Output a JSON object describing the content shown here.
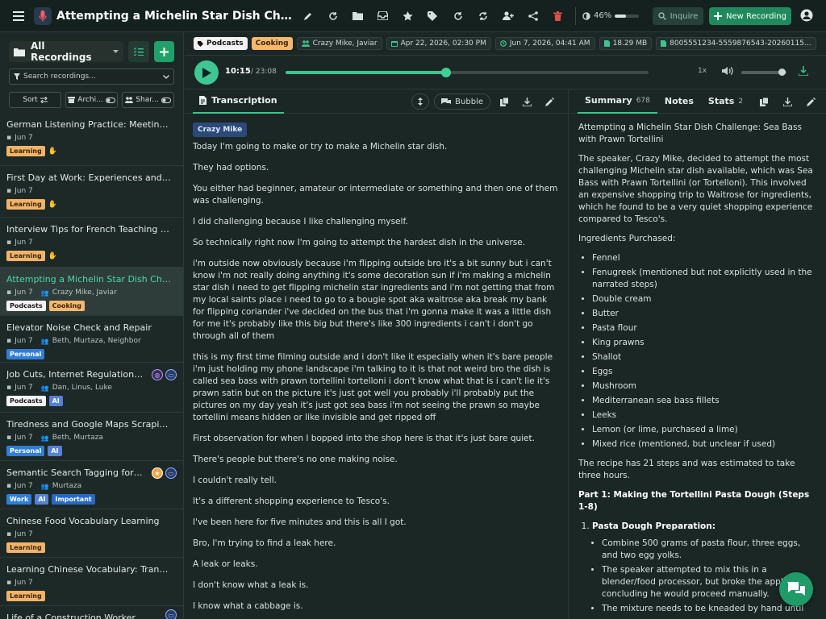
{
  "header": {
    "title": "Attempting a Michelin Star Dish Challenge: Sea Bass with Prawn Tortellini",
    "battery": {
      "percent_label": "46%",
      "fraction": 0.46
    },
    "inquire_label": "Inquire",
    "new_recording_label": "New Recording",
    "icons": [
      "menu-icon",
      "microphone-icon",
      "edit-icon",
      "refresh-icon",
      "folder-icon",
      "inbox-icon",
      "star-icon",
      "tag-icon",
      "redo-icon",
      "sync-icon",
      "user-add-icon",
      "share-icon",
      "delete-icon",
      "battery-icon",
      "search-icon",
      "plus-icon",
      "account-icon"
    ]
  },
  "sidebar": {
    "header_label": "All Recordings",
    "search_placeholder": "Search recordings...",
    "filters": {
      "sort_label": "Sort",
      "archive_label": "Archi...",
      "shared_label": "Shar..."
    },
    "recordings": [
      {
        "title": "German Listening Practice: Meeting New People",
        "date": "Jun 7",
        "participants": "",
        "tags": [
          {
            "label": "Learning",
            "kind": "learning"
          }
        ],
        "has_kb": true,
        "badges": []
      },
      {
        "title": "First Day at Work: Experiences and Challenges",
        "date": "Jun 7",
        "participants": "",
        "tags": [
          {
            "label": "Learning",
            "kind": "learning"
          }
        ],
        "has_kb": true,
        "badges": []
      },
      {
        "title": "Interview Tips for French Teaching Position",
        "date": "Jun 7",
        "participants": "",
        "tags": [
          {
            "label": "Learning",
            "kind": "learning"
          }
        ],
        "has_kb": true,
        "badges": []
      },
      {
        "title": "Attempting a Michelin Star Dish Challenge",
        "date": "Jun 7",
        "participants": "Crazy Mike, Javiar",
        "tags": [
          {
            "label": "Podcasts",
            "kind": "podcasts"
          },
          {
            "label": "Cooking",
            "kind": "cooking"
          }
        ],
        "has_kb": false,
        "badges": [],
        "active": true
      },
      {
        "title": "Elevator Noise Check and Repair",
        "date": "Jun 7",
        "participants": "Beth, Murtaza, Neighbor",
        "tags": [
          {
            "label": "Personal",
            "kind": "personal"
          }
        ],
        "has_kb": false,
        "badges": []
      },
      {
        "title": "Job Cuts, Internet Regulations, and Tech",
        "date": "Jun 7",
        "participants": "Dan, Linus, Luke",
        "tags": [
          {
            "label": "Podcasts",
            "kind": "podcasts"
          },
          {
            "label": "AI",
            "kind": "ai"
          }
        ],
        "has_kb": false,
        "badges": [
          "globe",
          "inbox"
        ]
      },
      {
        "title": "Tiredness and Google Maps Scraping Ideas",
        "date": "Jun 7",
        "participants": "Beth, Murtaza",
        "tags": [
          {
            "label": "Personal",
            "kind": "personal"
          },
          {
            "label": "AI",
            "kind": "ai"
          }
        ],
        "has_kb": false,
        "badges": []
      },
      {
        "title": "Semantic Search Tagging for Transcripts",
        "date": "Jun 7",
        "participants": "Murtaza",
        "tags": [
          {
            "label": "Work",
            "kind": "work"
          },
          {
            "label": "AI",
            "kind": "ai"
          },
          {
            "label": "Important",
            "kind": "important"
          }
        ],
        "has_kb": false,
        "badges": [
          "star",
          "inbox"
        ]
      },
      {
        "title": "Chinese Food Vocabulary Learning",
        "date": "Jun 7",
        "participants": "",
        "tags": [
          {
            "label": "Learning",
            "kind": "learning"
          }
        ],
        "has_kb": false,
        "badges": []
      },
      {
        "title": "Learning Chinese Vocabulary: Transportation",
        "date": "Jun 7",
        "participants": "",
        "tags": [
          {
            "label": "Learning",
            "kind": "learning"
          }
        ],
        "has_kb": false,
        "badges": []
      },
      {
        "title": "Life of a Construction Worker",
        "date": "",
        "participants": "",
        "tags": [],
        "has_kb": false,
        "badges": [
          "inbox"
        ]
      }
    ]
  },
  "meta": {
    "tags": [
      "Podcasts",
      "Cooking"
    ],
    "participants": "Crazy Mike, Javiar",
    "created": "Apr 22, 2026, 02:30 PM",
    "processed": "Jun 7, 2026, 04:41 AM",
    "size": "18.29 MB",
    "file_id": "8005551234-5559876543-20260115..."
  },
  "player": {
    "current": "10:15",
    "total": "/ 23:08",
    "progress": 0.443,
    "speed": "1x",
    "volume": 0.9
  },
  "transcription": {
    "tab_label": "Transcription",
    "bubble_label": "Bubble",
    "speaker": "Crazy Mike",
    "paragraphs": [
      "Today I'm going to make or try to make a Michelin star dish.",
      "They had options.",
      "You either had beginner, amateur or intermediate or something and then one of them was challenging.",
      "I did challenging because I like challenging myself.",
      "So technically right now I'm going to attempt the hardest dish in the universe.",
      "i'm outside now obviously because i'm flipping outside bro it's a bit sunny but i can't know i'm not really doing anything it's some decoration sun if i'm making a michelin star dish i need to get flipping michelin star ingredients and i'm not getting that from my local saints place i need to go to a bougie spot aka waitrose aka break my bank for flipping coriander i've decided on the bus that i'm gonna make it was a little dish for me it's probably like this big but there's like 300 ingredients i can't i don't go through all of them",
      "this is my first time filming outside and i don't like it especially when it's bare people i'm just holding my phone landscape i'm talking to it is that not weird bro the dish is called sea bass with prawn tortellini tortelloni i don't know what that is i can't lie it's prawn satin but on the picture it's just got well you probably i'll probably put the pictures on my day yeah it's just got sea bass i'm not seeing the prawn so maybe tortellini means hidden or like invisible and get ripped off",
      "First observation for when I bopped into the shop here is that it's just bare quiet.",
      "There's people but there's no one making noise.",
      "I couldn't really tell.",
      "It's a different shopping experience to Tesco's.",
      "I've been here for five minutes and this is all I got.",
      "Bro, I'm trying to find a leak here.",
      "A leak or leaks.",
      "I don't know what a leak is.",
      "I know what a cabbage is."
    ]
  },
  "summary": {
    "tabs": [
      {
        "label": "Summary",
        "count": "678"
      },
      {
        "label": "Notes",
        "count": ""
      },
      {
        "label": "Stats",
        "count": "2"
      }
    ],
    "title": "Attempting a Michelin Star Dish Challenge: Sea Bass with Prawn Tortellini",
    "intro": "The speaker, Crazy Mike, decided to attempt the most challenging Michelin star dish available, which was Sea Bass with Prawn Tortellini (or Tortelloni). This involved an expensive shopping trip to Waitrose for ingredients, which he found to be a very quiet shopping experience compared to Tesco's.",
    "ingredients_heading": "Ingredients Purchased:",
    "ingredients": [
      "Fennel",
      "Fenugreek (mentioned but not explicitly used in the narrated steps)",
      "Double cream",
      "Butter",
      "Pasta flour",
      "King prawns",
      "Shallot",
      "Eggs",
      "Mushroom",
      "Mediterranean sea bass fillets",
      "Leeks",
      "Lemon (or lime, purchased a lime)",
      "Mixed rice (mentioned, but unclear if used)"
    ],
    "recipe_note": "The recipe has 21 steps and was estimated to take three hours.",
    "part1_heading": "Part 1: Making the Tortellini Pasta Dough (Steps 1-8)",
    "step1_title": "Pasta Dough Preparation:",
    "step1_items": [
      "Combine 500 grams of pasta flour, three eggs, and two egg yolks.",
      "The speaker attempted to mix this in a blender/food processor, but broke the appliance, concluding he would proceed manually.",
      "The mixture needs to be kneaded by hand until"
    ]
  },
  "colors": {
    "accent": "#3cc48f",
    "new_recording_bg": "#1f8a5e",
    "delete_red": "#e0504a",
    "active_title": "#4cd6a4"
  }
}
